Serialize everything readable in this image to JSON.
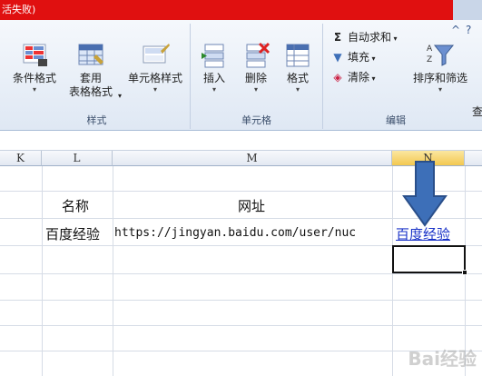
{
  "window": {
    "title": "活失败)"
  },
  "ribbon": {
    "styles_group": {
      "label": "样式",
      "conditional_format": "条件格式",
      "table_format_line1": "套用",
      "table_format_line2": "表格格式",
      "cell_styles": "单元格样式"
    },
    "cells_group": {
      "label": "单元格",
      "insert": "插入",
      "delete": "删除",
      "format": "格式"
    },
    "editing_group": {
      "label": "编辑",
      "autosum": "自动求和",
      "fill": "填充",
      "clear": "清除",
      "sort_filter": "排序和筛选",
      "find_select_partial": "查"
    },
    "controls": {
      "help": "?",
      "collapse": "^"
    }
  },
  "grid": {
    "columns": [
      "K",
      "L",
      "M",
      "N"
    ],
    "selected_column": "N",
    "rows": [
      {
        "L": "名称",
        "M": "网址",
        "N": ""
      },
      {
        "L": "百度经验",
        "M": "https://jingyan.baidu.com/user/nuc",
        "N": "百度经验"
      }
    ]
  },
  "watermark": "Bai经验",
  "colors": {
    "titlebar": "#e01010",
    "selected_header": "#f3c850",
    "link": "#1a33c8",
    "arrow": "#3d6fb8"
  }
}
